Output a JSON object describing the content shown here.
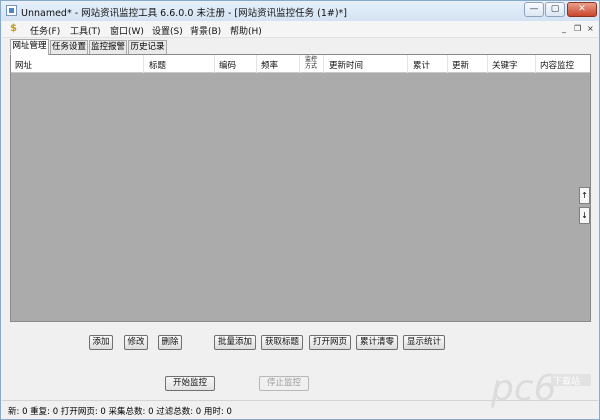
{
  "window": {
    "title": "Unnamed* - 网站资讯监控工具 6.6.0.0  未注册 - [网站资讯监控任务  (1#)*]",
    "min_glyph": "—",
    "max_glyph": "▢",
    "close_glyph": "✕"
  },
  "menubar": {
    "logo_glyph": "$",
    "items": [
      "任务(F)",
      "工具(T)",
      "窗口(W)",
      "设置(S)",
      "背景(B)",
      "帮助(H)"
    ],
    "mdi_glyphs": [
      "_",
      "❐",
      "×"
    ]
  },
  "tabs": [
    "网址管理",
    "任务设置",
    "监控报警",
    "历史记录"
  ],
  "grid": {
    "columns": [
      "网址",
      "标题",
      "编码",
      "频率",
      "监控方式",
      "更新时间",
      "累计",
      "更新",
      "关键字",
      "内容监控"
    ],
    "stacked_column": [
      "监控",
      "方式"
    ],
    "rows": [],
    "scroll_up_glyph": "↑",
    "scroll_down_glyph": "↓"
  },
  "buttons": {
    "add": "添加",
    "edit": "修改",
    "delete": "删除",
    "batch_add": "批量添加",
    "fetch_title": "获取标题",
    "open_page": "打开网页",
    "clear_total": "累计清零",
    "show_stats": "显示统计",
    "start_monitor": "开始监控",
    "stop_monitor": "停止监控"
  },
  "statusbar": {
    "text": "新: 0  重复: 0  打开网页: 0  采集总数: 0  过滤总数: 0  用时: 0"
  },
  "watermark": {
    "logo_text": "pc6",
    "caption": "下载站"
  },
  "colors": {
    "grid_background": "#ababab",
    "watermark": "#d9d9d9",
    "title_gradient_top": "#e6f0fa",
    "close_button": "#c9452c"
  }
}
